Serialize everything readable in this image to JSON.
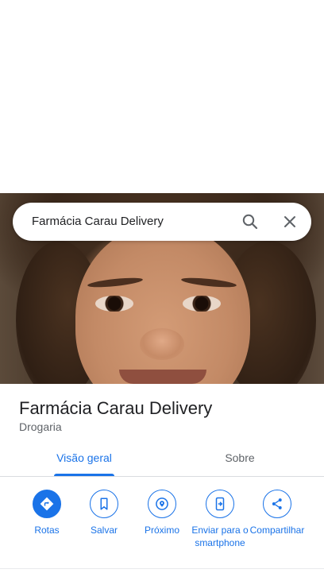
{
  "search": {
    "query": "Farmácia Carau Delivery"
  },
  "place": {
    "name": "Farmácia Carau Delivery",
    "category": "Drogaria"
  },
  "tabs": [
    {
      "label": "Visão geral",
      "selected": true
    },
    {
      "label": "Sobre",
      "selected": false
    }
  ],
  "actions": {
    "routes": {
      "label": "Rotas",
      "icon": "directions-icon"
    },
    "save": {
      "label": "Salvar",
      "icon": "bookmark-icon"
    },
    "nearby": {
      "label": "Próximo",
      "icon": "nearby-icon"
    },
    "send": {
      "label": "Enviar para o smartphone",
      "icon": "send-to-phone-icon"
    },
    "share": {
      "label": "Compartilhar",
      "icon": "share-icon"
    }
  },
  "colors": {
    "accent": "#1a73e8",
    "text_primary": "#202124",
    "text_secondary": "#5f6368"
  }
}
